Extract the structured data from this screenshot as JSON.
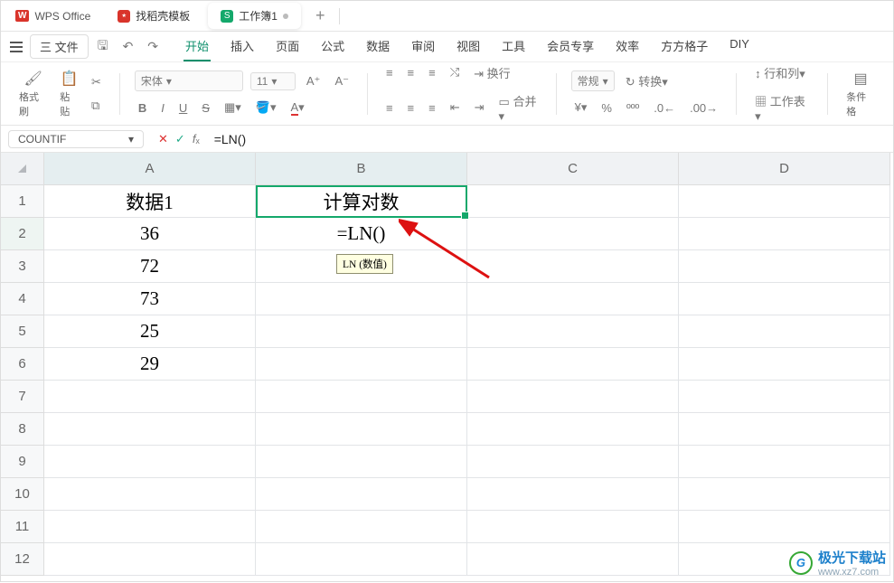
{
  "titlebar": {
    "brand": "WPS Office",
    "tabs": [
      {
        "icon_bg": "#d9342b",
        "icon_text": "",
        "label": "找稻壳模板"
      },
      {
        "icon_bg": "#14a86b",
        "icon_text": "S",
        "label": "工作簿1"
      }
    ],
    "newtab": "+"
  },
  "menubar": {
    "file": "三 文件",
    "items": [
      "开始",
      "插入",
      "页面",
      "公式",
      "数据",
      "审阅",
      "视图",
      "工具",
      "会员专享",
      "效率",
      "方方格子",
      "DIY"
    ]
  },
  "ribbon": {
    "brush": "格式刷",
    "paste": "粘贴",
    "font_name": "宋体",
    "font_size": "11",
    "wrap": "换行",
    "merge": "合并",
    "numfmt": "常规",
    "convert": "转换",
    "rowcol": "行和列",
    "sheet": "工作表",
    "cond": "条件格"
  },
  "formula_bar": {
    "namebox": "COUNTIF",
    "formula": "=LN()"
  },
  "sheet": {
    "col_headers": [
      "A",
      "B",
      "C",
      "D"
    ],
    "rows": [
      {
        "n": "1",
        "A": "数据1",
        "B": "计算对数"
      },
      {
        "n": "2",
        "A": "36",
        "B": "=LN()"
      },
      {
        "n": "3",
        "A": "72",
        "B": ""
      },
      {
        "n": "4",
        "A": "73",
        "B": ""
      },
      {
        "n": "5",
        "A": "25",
        "B": ""
      },
      {
        "n": "6",
        "A": "29",
        "B": ""
      },
      {
        "n": "7",
        "A": "",
        "B": ""
      },
      {
        "n": "8",
        "A": "",
        "B": ""
      },
      {
        "n": "9",
        "A": "",
        "B": ""
      },
      {
        "n": "10",
        "A": "",
        "B": ""
      },
      {
        "n": "11",
        "A": "",
        "B": ""
      },
      {
        "n": "12",
        "A": "",
        "B": ""
      }
    ],
    "tooltip": "LN (数值)"
  },
  "watermark": {
    "name": "极光下载站",
    "url": "www.xz7.com"
  }
}
